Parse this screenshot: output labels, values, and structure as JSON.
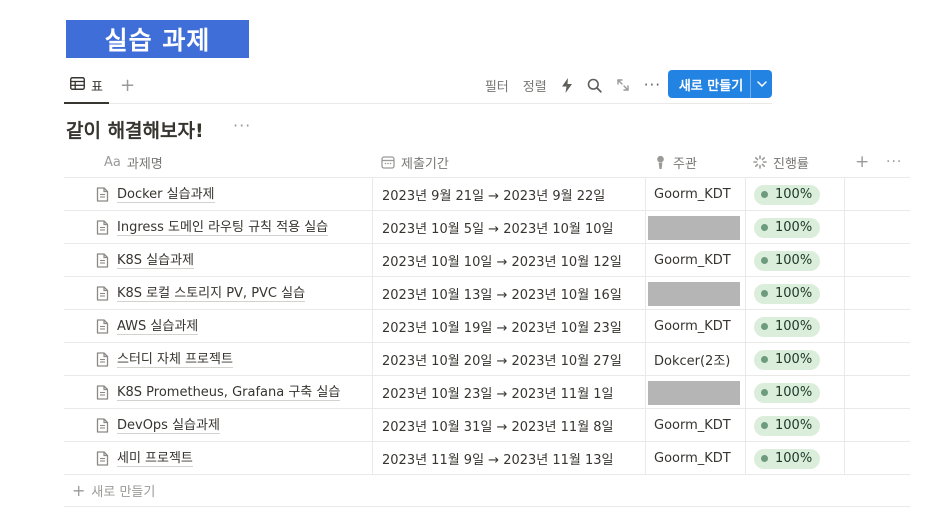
{
  "banner": {
    "text": "실습 과제"
  },
  "view": {
    "tab_label": "표",
    "filter_label": "필터",
    "sort_label": "정렬",
    "new_label": "새로 만들기"
  },
  "database": {
    "title": "같이 해결해보자!",
    "more": "···"
  },
  "columns": {
    "name_prefix": "Aa",
    "name": "과제명",
    "date": "제출기간",
    "owner": "주관",
    "progress": "진행률",
    "add": "+",
    "more": "···"
  },
  "rows": [
    {
      "name": "Docker 실습과제",
      "date": "2023년 9월 21일 → 2023년 9월 22일",
      "owner": "Goorm_KDT",
      "progress": "100%"
    },
    {
      "name": "Ingress 도메인 라우팅 규칙 적용 실습",
      "date": "2023년 10월 5일 → 2023년 10월 10일",
      "owner": "",
      "progress": "100%"
    },
    {
      "name": "K8S 실습과제",
      "date": "2023년 10월 10일 → 2023년 10월 12일",
      "owner": "Goorm_KDT",
      "progress": "100%"
    },
    {
      "name": "K8S 로컬 스토리지 PV, PVC 실습",
      "date": "2023년 10월 13일 → 2023년 10월 16일",
      "owner": "",
      "progress": "100%"
    },
    {
      "name": "AWS 실습과제",
      "date": "2023년 10월 19일 → 2023년 10월 23일",
      "owner": "Goorm_KDT",
      "progress": "100%"
    },
    {
      "name": "스터디 자체 프로젝트",
      "date": "2023년 10월 20일 → 2023년 10월 27일",
      "owner": "Dokcer(2조)",
      "progress": "100%"
    },
    {
      "name": "K8S Prometheus, Grafana 구축 실습",
      "date": "2023년 10월 23일 → 2023년 11월 1일",
      "owner": "",
      "progress": "100%"
    },
    {
      "name": "DevOps 실습과제",
      "date": "2023년 10월 31일 → 2023년 11월 8일",
      "owner": "Goorm_KDT",
      "progress": "100%"
    },
    {
      "name": "세미 프로젝트",
      "date": "2023년 11월 9일 → 2023년 11월 13일",
      "owner": "Goorm_KDT",
      "progress": "100%"
    }
  ],
  "new_row_label": "새로 만들기",
  "colors": {
    "accent": "#2383e2",
    "banner": "#3f6ed8",
    "badge_bg": "#dbeddb",
    "badge_dot": "#6c9b7d"
  }
}
